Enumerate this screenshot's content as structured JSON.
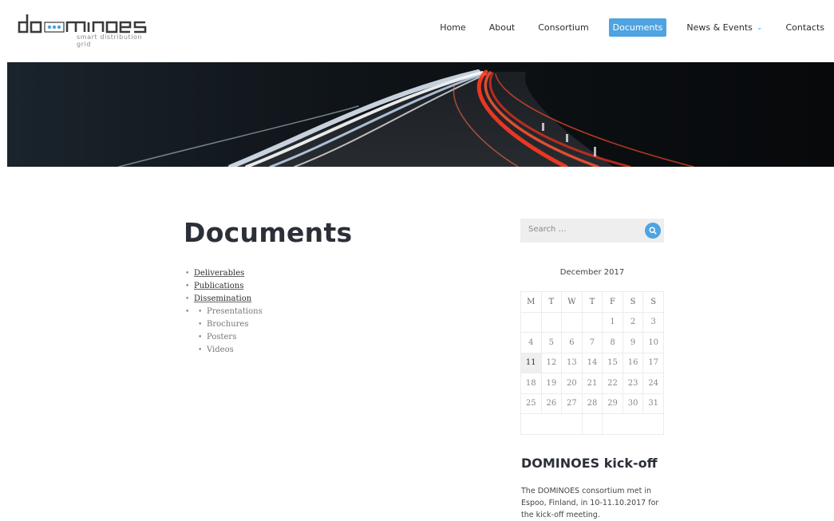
{
  "header": {
    "logo_text": "dominoes",
    "logo_tagline": "smart distribution grid",
    "nav": [
      {
        "label": "Home"
      },
      {
        "label": "About"
      },
      {
        "label": "Consortium"
      },
      {
        "label": "Documents",
        "active": true
      },
      {
        "label": "News & Events",
        "has_dropdown": true
      },
      {
        "label": "Contacts"
      }
    ]
  },
  "hero": {
    "icon": "highway-light-trails-image"
  },
  "main": {
    "title": "Documents",
    "items": [
      "Deliverables",
      "Publications",
      "Dissemination"
    ],
    "dissemination_sub": [
      "Presentations",
      "Brochures",
      "Posters",
      "Videos"
    ]
  },
  "sidebar": {
    "search": {
      "placeholder": "Search …",
      "icon": "search-icon"
    },
    "calendar": {
      "caption": "December 2017",
      "weekdays": [
        "M",
        "T",
        "W",
        "T",
        "F",
        "S",
        "S"
      ],
      "weeks": [
        [
          "",
          "",
          "",
          "",
          "1",
          "2",
          "3"
        ],
        [
          "4",
          "5",
          "6",
          "7",
          "8",
          "9",
          "10"
        ],
        [
          "11",
          "12",
          "13",
          "14",
          "15",
          "16",
          "17"
        ],
        [
          "18",
          "19",
          "20",
          "21",
          "22",
          "23",
          "24"
        ],
        [
          "25",
          "26",
          "27",
          "28",
          "29",
          "30",
          "31"
        ]
      ],
      "today": "11"
    },
    "news": {
      "title": "DOMINOES kick-off",
      "text": "The DOMINOES consortium met in Espoo, Finland, in 10-11.10.2017 for the kick-off meeting."
    }
  },
  "colors": {
    "accent": "#4fa3e0",
    "heading": "#2b2f38"
  }
}
